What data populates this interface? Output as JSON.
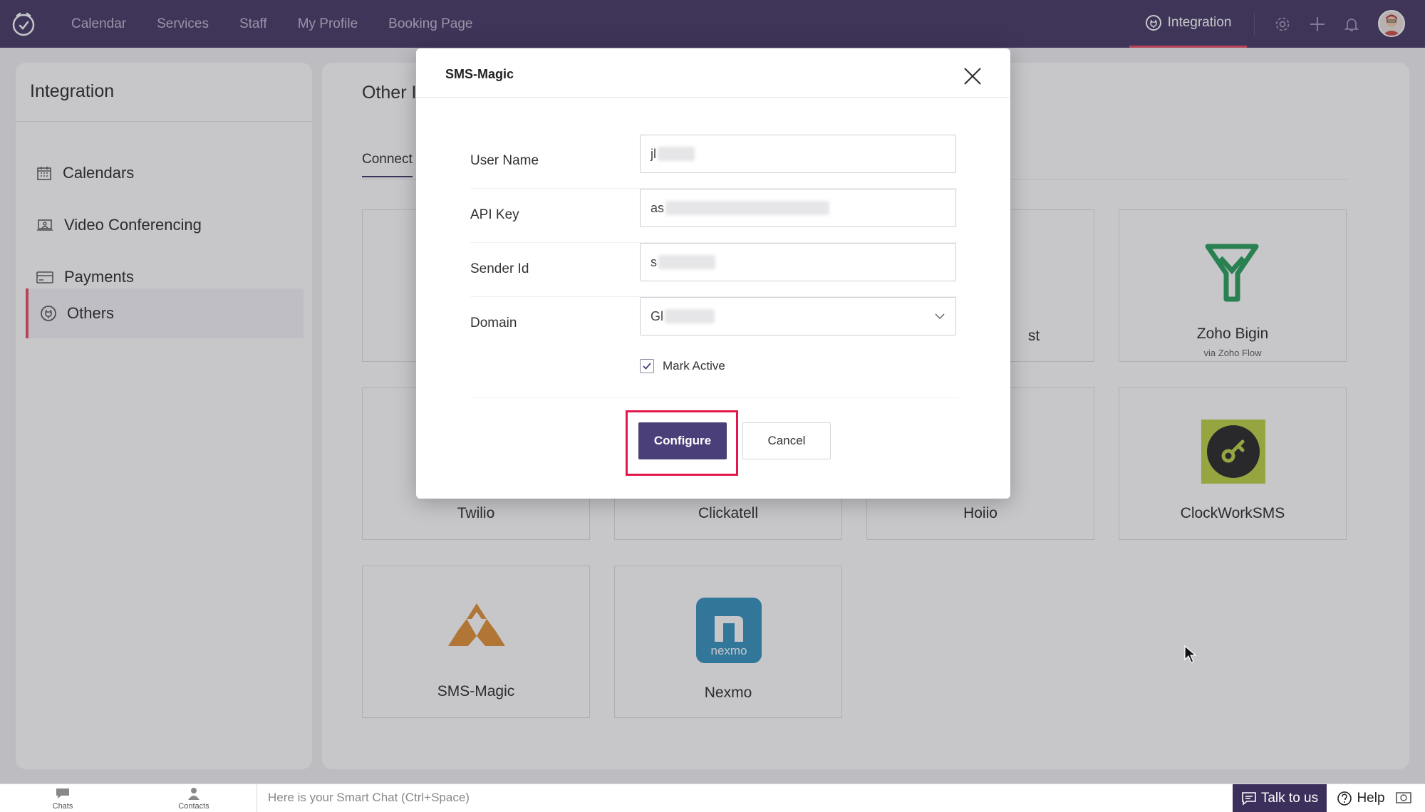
{
  "topbar": {
    "nav": [
      "Calendar",
      "Services",
      "Staff",
      "My Profile",
      "Booking Page"
    ],
    "active_tab": "Integration"
  },
  "sidebar": {
    "title": "Integration",
    "items": [
      {
        "label": "Calendars",
        "icon": "calendar-icon"
      },
      {
        "label": "Video Conferencing",
        "icon": "video-icon"
      },
      {
        "label": "Payments",
        "icon": "card-icon"
      },
      {
        "label": "Others",
        "icon": "plug-icon",
        "active": true
      }
    ]
  },
  "content": {
    "title": "Other Integrations",
    "tab": "Connect",
    "cards": [
      {
        "label": "Zoho Bigin",
        "sub": "via Zoho Flow"
      },
      {
        "label": "Twilio"
      },
      {
        "label": "Clickatell"
      },
      {
        "label": "Hoiio"
      },
      {
        "label": "ClockWorkSMS"
      },
      {
        "label": "SMS-Magic"
      },
      {
        "label": "Nexmo"
      }
    ],
    "partial_label": "st"
  },
  "modal": {
    "title": "SMS-Magic",
    "fields": [
      {
        "label": "User Name",
        "value": "jl"
      },
      {
        "label": "API Key",
        "value": "as"
      },
      {
        "label": "Sender Id",
        "value": "s"
      },
      {
        "label": "Domain",
        "value": "Gl"
      }
    ],
    "checkbox_label": "Mark Active",
    "configure_label": "Configure",
    "cancel_label": "Cancel"
  },
  "bottombar": {
    "chats": "Chats",
    "contacts": "Contacts",
    "smart_chat": "Here is your Smart Chat (Ctrl+Space)",
    "talk": "Talk to us",
    "help": "Help"
  },
  "colors": {
    "nav_bg": "#3d2f5c",
    "accent": "#e9425a",
    "primary_button": "#4a3f78",
    "highlight": "#e2184a"
  }
}
